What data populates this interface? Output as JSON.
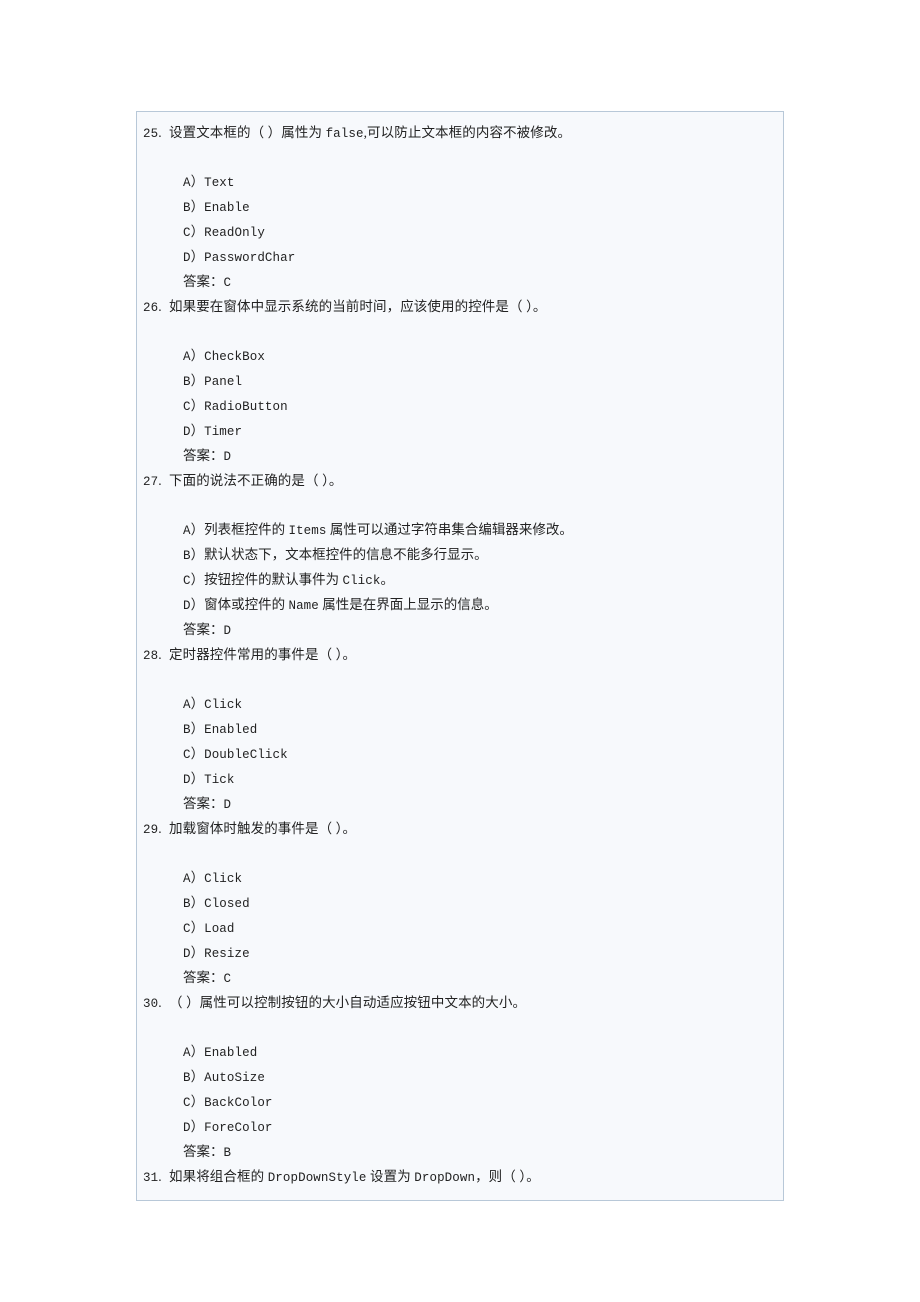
{
  "document": {
    "page_background": "#ffffff",
    "content_box": {
      "background": "#f7f9fc",
      "border_color": "#b8c8d8"
    },
    "answer_label": "答案:"
  },
  "questions": [
    {
      "number": "25.",
      "stem": "设置文本框的（ ）属性为 false,可以防止文本框的内容不被修改。",
      "options": [
        "A）Text",
        "B）Enable",
        "C）ReadOnly",
        "D）PasswordChar"
      ],
      "answer": "答案：C"
    },
    {
      "number": "26.",
      "stem": "如果要在窗体中显示系统的当前时间，应该使用的控件是（ ）。",
      "options": [
        "A）CheckBox",
        "B）Panel",
        "C）RadioButton",
        "D）Timer"
      ],
      "answer": "答案：D"
    },
    {
      "number": "27.",
      "stem": "下面的说法不正确的是（ ）。",
      "options": [
        "A）列表框控件的 Items 属性可以通过字符串集合编辑器来修改。",
        "B）默认状态下，文本框控件的信息不能多行显示。",
        "C）按钮控件的默认事件为 Click。",
        "D）窗体或控件的 Name 属性是在界面上显示的信息。"
      ],
      "answer": "答案：D"
    },
    {
      "number": "28.",
      "stem": "定时器控件常用的事件是（ ）。",
      "options": [
        "A）Click",
        "B）Enabled",
        "C）DoubleClick",
        "D）Tick"
      ],
      "answer": "答案：D"
    },
    {
      "number": "29.",
      "stem": "加载窗体时触发的事件是（ ）。",
      "options": [
        "A）Click",
        "B）Closed",
        "C）Load",
        "D）Resize"
      ],
      "answer": "答案：C"
    },
    {
      "number": "30.",
      "stem": "（ ）属性可以控制按钮的大小自动适应按钮中文本的大小。",
      "options": [
        "A）Enabled",
        "B）AutoSize",
        "C）BackColor",
        "D）ForeColor"
      ],
      "answer": "答案：B"
    },
    {
      "number": "31.",
      "stem": "如果将组合框的 DropDownStyle 设置为 DropDown，则（ ）。",
      "options": [],
      "answer": ""
    }
  ]
}
